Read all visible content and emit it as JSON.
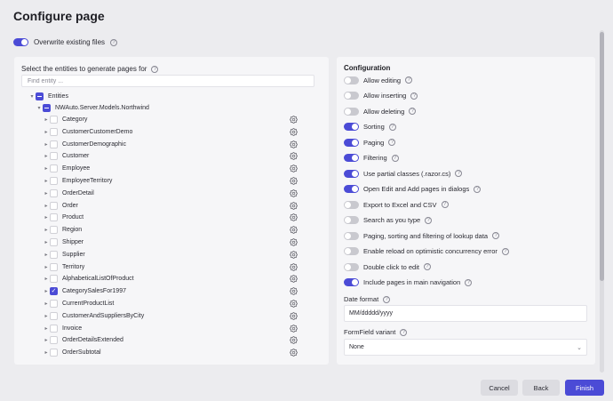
{
  "dialog": {
    "title": "Configure page"
  },
  "overwrite": {
    "label": "Overwrite existing files",
    "on": true
  },
  "entities_panel": {
    "heading": "Select the entities to generate pages for",
    "search_placeholder": "Find entity ...",
    "root_label": "Entities",
    "model_label": "NWAuto.Server.Models.Northwind",
    "items": [
      {
        "label": "Category",
        "checked": false
      },
      {
        "label": "CustomerCustomerDemo",
        "checked": false
      },
      {
        "label": "CustomerDemographic",
        "checked": false
      },
      {
        "label": "Customer",
        "checked": false
      },
      {
        "label": "Employee",
        "checked": false
      },
      {
        "label": "EmployeeTerritory",
        "checked": false
      },
      {
        "label": "OrderDetail",
        "checked": false
      },
      {
        "label": "Order",
        "checked": false
      },
      {
        "label": "Product",
        "checked": false
      },
      {
        "label": "Region",
        "checked": false
      },
      {
        "label": "Shipper",
        "checked": false
      },
      {
        "label": "Supplier",
        "checked": false
      },
      {
        "label": "Territory",
        "checked": false
      },
      {
        "label": "AlphabeticalListOfProduct",
        "checked": false
      },
      {
        "label": "CategorySalesFor1997",
        "checked": true
      },
      {
        "label": "CurrentProductList",
        "checked": false
      },
      {
        "label": "CustomerAndSuppliersByCity",
        "checked": false
      },
      {
        "label": "Invoice",
        "checked": false
      },
      {
        "label": "OrderDetailsExtended",
        "checked": false
      },
      {
        "label": "OrderSubtotal",
        "checked": false
      }
    ]
  },
  "configuration": {
    "heading": "Configuration",
    "options": [
      {
        "label": "Allow editing",
        "on": false
      },
      {
        "label": "Allow inserting",
        "on": false
      },
      {
        "label": "Allow deleting",
        "on": false
      },
      {
        "label": "Sorting",
        "on": true
      },
      {
        "label": "Paging",
        "on": true
      },
      {
        "label": "Filtering",
        "on": true
      },
      {
        "label": "Use partial classes (.razor.cs)",
        "on": true
      },
      {
        "label": "Open Edit and Add pages in dialogs",
        "on": true
      },
      {
        "label": "Export to Excel and CSV",
        "on": false
      },
      {
        "label": "Search as you type",
        "on": false
      },
      {
        "label": "Paging, sorting and filtering of lookup data",
        "on": false
      },
      {
        "label": "Enable reload on optimistic concurrency error",
        "on": false
      },
      {
        "label": "Double click to edit",
        "on": false
      },
      {
        "label": "Include pages in main navigation",
        "on": true
      }
    ],
    "date_format": {
      "label": "Date format",
      "value": "MM/ddddd/yyyy"
    },
    "formfield_variant": {
      "label": "FormField variant",
      "value": "None"
    }
  },
  "footer": {
    "cancel": "Cancel",
    "back": "Back",
    "finish": "Finish"
  }
}
